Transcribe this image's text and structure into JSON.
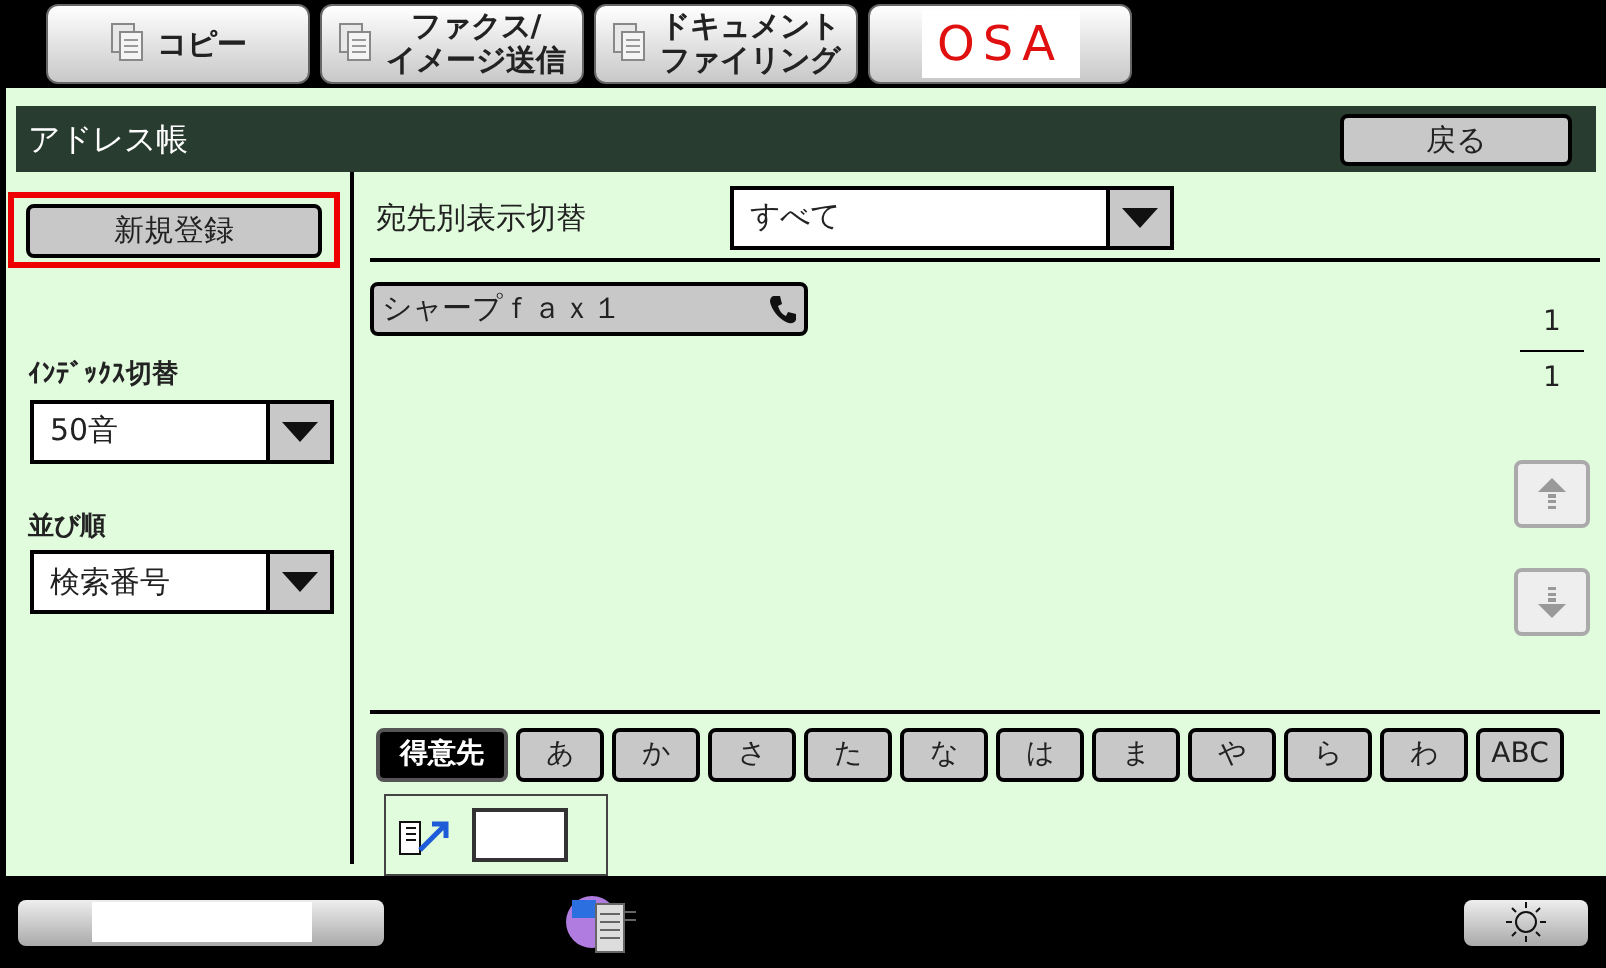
{
  "top_tabs": [
    {
      "kind": "copy",
      "lines": [
        "コピー"
      ]
    },
    {
      "kind": "fax",
      "lines": [
        "ファクス/",
        "イメージ送信"
      ]
    },
    {
      "kind": "filing",
      "lines": [
        "ドキュメント",
        "ファイリング"
      ]
    },
    {
      "kind": "logo",
      "lines": [
        "OSA"
      ]
    }
  ],
  "title_bar": {
    "title": "アドレス帳",
    "back_button": "戻る"
  },
  "new_button": {
    "label": "新規登録",
    "highlighted": true
  },
  "index_switch": {
    "label": "ｲﾝﾃﾞｯｸｽ切替",
    "value": "50音"
  },
  "sort_order": {
    "label": "並び順",
    "value": "検索番号"
  },
  "destination_filter": {
    "label": "宛先別表示切替",
    "value": "すべて"
  },
  "entries": [
    {
      "name": "シャープｆａｘ１",
      "kind": "fax"
    }
  ],
  "page": {
    "current": "1",
    "total": "1"
  },
  "scroll": {
    "up_disabled": true,
    "down_disabled": true
  },
  "index_tabs": [
    {
      "label": "得意先",
      "selected": true
    },
    {
      "label": "あ",
      "selected": false
    },
    {
      "label": "か",
      "selected": false
    },
    {
      "label": "さ",
      "selected": false
    },
    {
      "label": "た",
      "selected": false
    },
    {
      "label": "な",
      "selected": false
    },
    {
      "label": "は",
      "selected": false
    },
    {
      "label": "ま",
      "selected": false
    },
    {
      "label": "や",
      "selected": false
    },
    {
      "label": "ら",
      "selected": false
    },
    {
      "label": "わ",
      "selected": false
    },
    {
      "label": "ABC",
      "selected": false
    }
  ]
}
